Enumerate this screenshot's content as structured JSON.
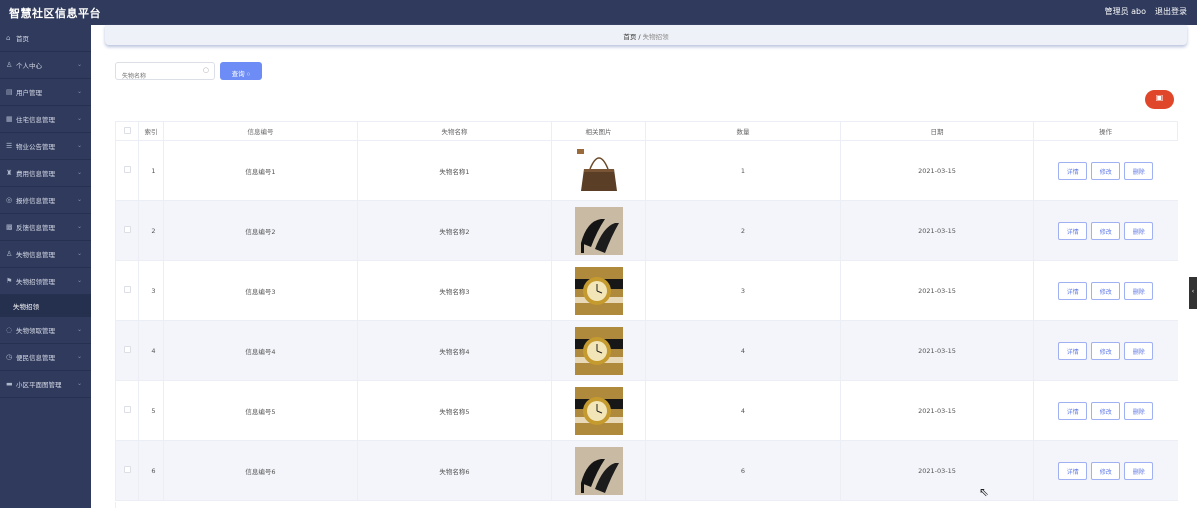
{
  "header": {
    "brand": "智慧社区信息平台",
    "user": "管理员 abo",
    "logout": "退出登录"
  },
  "sidebar": {
    "items": [
      {
        "icon": "⌂",
        "label": "首页",
        "chevron": false
      },
      {
        "icon": "♙",
        "label": "个人中心",
        "chevron": true
      },
      {
        "icon": "▤",
        "label": "用户管理",
        "chevron": true
      },
      {
        "icon": "▦",
        "label": "住宅信息管理",
        "chevron": true
      },
      {
        "icon": "☰",
        "label": "物业公告管理",
        "chevron": true
      },
      {
        "icon": "♜",
        "label": "费用信息管理",
        "chevron": true
      },
      {
        "icon": "◎",
        "label": "报修信息管理",
        "chevron": true
      },
      {
        "icon": "▩",
        "label": "反馈信息管理",
        "chevron": true
      },
      {
        "icon": "♙",
        "label": "失物信息管理",
        "chevron": true
      },
      {
        "icon": "⚑",
        "label": "失物招领管理",
        "chevron": true
      }
    ],
    "sub": "失物招领",
    "items2": [
      {
        "icon": "◌",
        "label": "失物领取管理",
        "chevron": true
      },
      {
        "icon": "◷",
        "label": "便民信息管理",
        "chevron": true
      },
      {
        "icon": "▬",
        "label": "小区平面图管理",
        "chevron": true
      }
    ]
  },
  "breadcrumb": {
    "home": "首页",
    "sep": "/",
    "current": "失物招领"
  },
  "search": {
    "placeholder": "失物名称",
    "button": "查询"
  },
  "table": {
    "headers": [
      "",
      "索引",
      "信息编号",
      "失物名称",
      "相关图片",
      "数量",
      "日期",
      "操作"
    ],
    "ops": [
      "详情",
      "修改",
      "删除"
    ],
    "rows": [
      {
        "index": "1",
        "code": "信息编号1",
        "name": "失物名称1",
        "img": "handbag",
        "qty": "1",
        "date": "2021-03-15"
      },
      {
        "index": "2",
        "code": "信息编号2",
        "name": "失物名称2",
        "img": "heels",
        "qty": "2",
        "date": "2021-03-15"
      },
      {
        "index": "3",
        "code": "信息编号3",
        "name": "失物名称3",
        "img": "watch",
        "qty": "3",
        "date": "2021-03-15"
      },
      {
        "index": "4",
        "code": "信息编号4",
        "name": "失物名称4",
        "img": "watch",
        "qty": "4",
        "date": "2021-03-15"
      },
      {
        "index": "5",
        "code": "信息编号5",
        "name": "失物名称5",
        "img": "watch",
        "qty": "4",
        "date": "2021-03-15"
      },
      {
        "index": "6",
        "code": "信息编号6",
        "name": "失物名称6",
        "img": "heels",
        "qty": "6",
        "date": "2021-03-15"
      }
    ]
  }
}
